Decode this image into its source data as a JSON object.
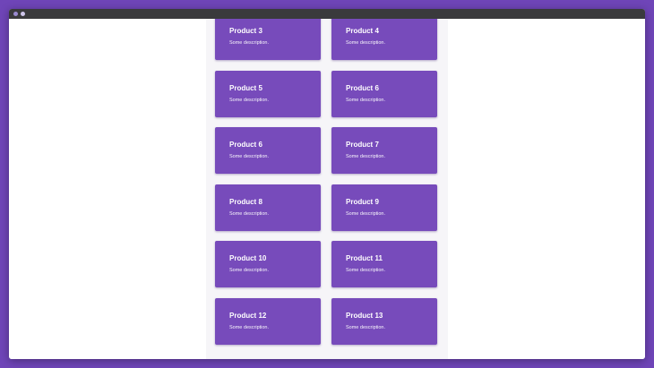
{
  "colors": {
    "background": "#6f45b8",
    "card": "#774bbb",
    "titlebar": "#3a3a3c",
    "panel": "#f6f5f8"
  },
  "window": {
    "controls": [
      "window-dot",
      "window-dot"
    ]
  },
  "products": [
    {
      "title": "Product 3",
      "description": "Some description."
    },
    {
      "title": "Product 4",
      "description": "Some description."
    },
    {
      "title": "Product 5",
      "description": "Some description."
    },
    {
      "title": "Product 6",
      "description": "Some description."
    },
    {
      "title": "Product 6",
      "description": "Some description."
    },
    {
      "title": "Product 7",
      "description": "Some description."
    },
    {
      "title": "Product 8",
      "description": "Some description."
    },
    {
      "title": "Product 9",
      "description": "Some description."
    },
    {
      "title": "Product 10",
      "description": "Some description."
    },
    {
      "title": "Product 11",
      "description": "Some description."
    },
    {
      "title": "Product 12",
      "description": "Some description."
    },
    {
      "title": "Product 13",
      "description": "Some description."
    }
  ]
}
